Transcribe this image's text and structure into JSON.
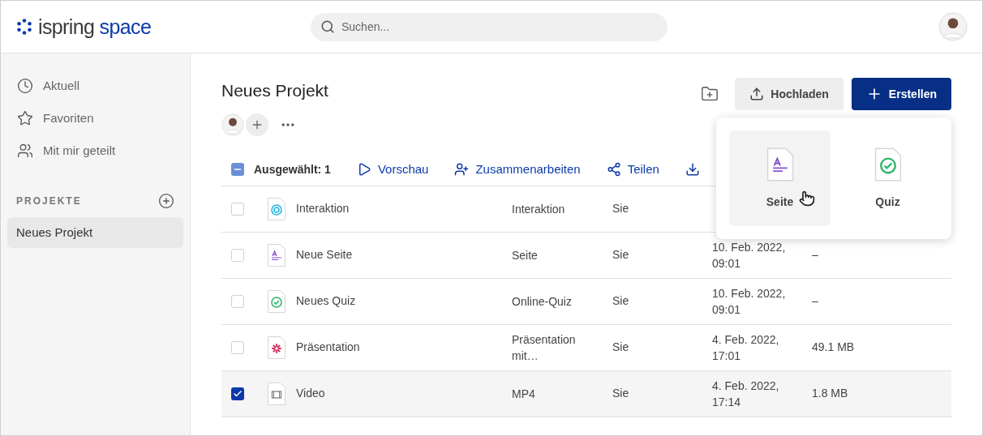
{
  "header": {
    "logo_dark": "ispring",
    "logo_blue": "space",
    "search": {
      "placeholder": "Suchen..."
    }
  },
  "sidebar": {
    "items": [
      {
        "label": "Aktuell"
      },
      {
        "label": "Favoriten"
      },
      {
        "label": "Mit mir geteilt"
      }
    ],
    "section": "PROJEKTE",
    "projects": [
      {
        "label": "Neues Projekt",
        "selected": true
      }
    ]
  },
  "project": {
    "title": "Neues Projekt",
    "upload": "Hochladen",
    "create": "Erstellen"
  },
  "toolbar": {
    "select_all_indeterminate": true,
    "selected_count": "Ausgewählt: 1",
    "actions": [
      {
        "label": "Vorschau"
      },
      {
        "label": "Zusammenarbeiten"
      },
      {
        "label": "Teilen"
      },
      {
        "kind": "download"
      }
    ]
  },
  "rows": [
    {
      "kind": "interaction",
      "name": "Interaktion",
      "type": [
        "Interaktion"
      ],
      "owner": "Sie",
      "checked": false
    },
    {
      "kind": "page",
      "name": "Neue Seite",
      "type": [
        "Seite"
      ],
      "owner": "Sie",
      "date": [
        "10. Feb. 2022,",
        "09:01"
      ],
      "size": "–",
      "checked": false
    },
    {
      "kind": "quiz",
      "name": "Neues Quiz",
      "type": [
        "Online-Quiz"
      ],
      "owner": "Sie",
      "date": [
        "10. Feb. 2022,",
        "09:01"
      ],
      "size": "–",
      "checked": false
    },
    {
      "kind": "presentation",
      "name": "Präsentation",
      "type": [
        "Präsentation",
        "mit…"
      ],
      "owner": "Sie",
      "date": [
        "4. Feb. 2022,",
        "17:01"
      ],
      "size": "49.1 MB",
      "checked": false
    },
    {
      "kind": "video",
      "name": "Video",
      "type": [
        "MP4"
      ],
      "owner": "Sie",
      "date": [
        "4. Feb. 2022,",
        "17:14"
      ],
      "size": "1.8 MB",
      "checked": true
    }
  ],
  "create_menu": [
    {
      "kind": "page",
      "label": "Seite",
      "selected": true
    },
    {
      "kind": "quiz",
      "label": "Quiz",
      "selected": false
    }
  ]
}
